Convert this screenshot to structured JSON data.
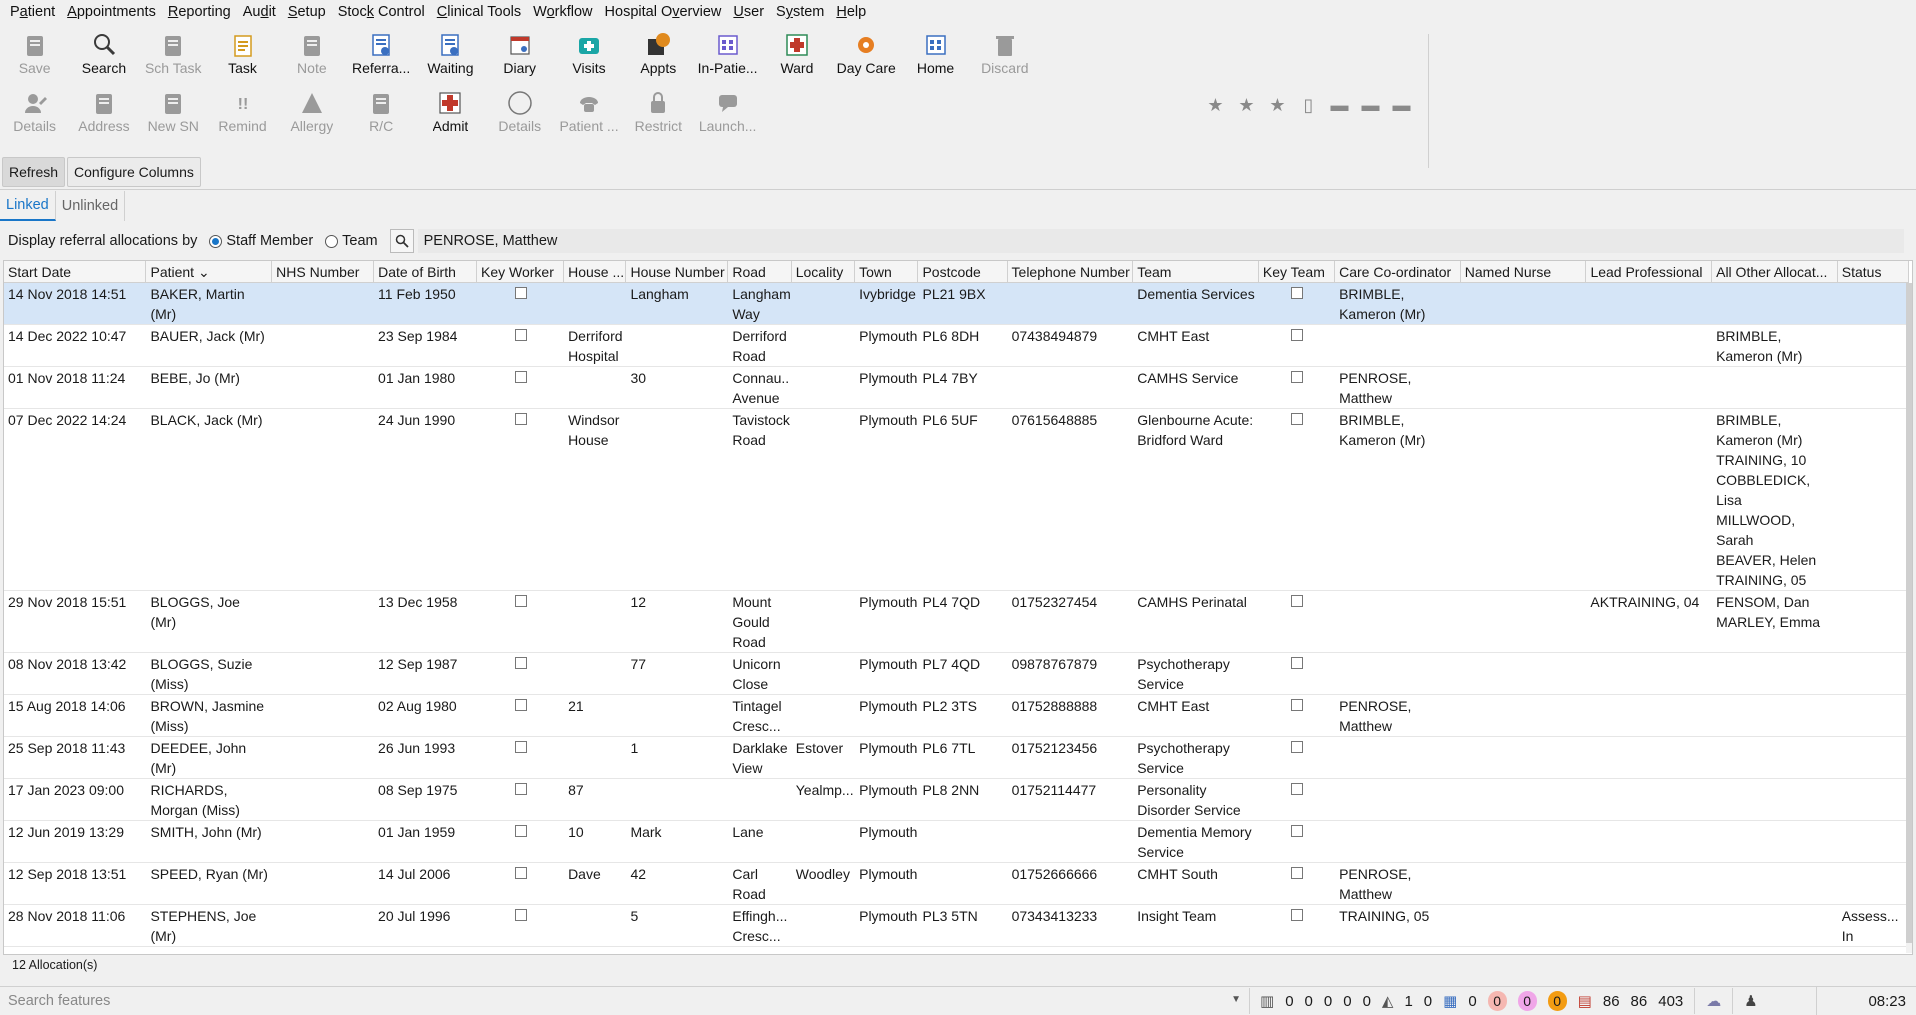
{
  "menu": [
    {
      "pre": "P",
      "ul": "a",
      "post": "tient"
    },
    {
      "pre": "",
      "ul": "A",
      "post": "ppointments"
    },
    {
      "pre": "",
      "ul": "R",
      "post": "eporting"
    },
    {
      "pre": "Au",
      "ul": "d",
      "post": "it"
    },
    {
      "pre": "",
      "ul": "S",
      "post": "etup"
    },
    {
      "pre": "Stoc",
      "ul": "k",
      "post": " Control"
    },
    {
      "pre": "",
      "ul": "C",
      "post": "linical Tools"
    },
    {
      "pre": "W",
      "ul": "o",
      "post": "rkflow"
    },
    {
      "pre": "Hospital O",
      "ul": "v",
      "post": "erview"
    },
    {
      "pre": "",
      "ul": "U",
      "post": "ser"
    },
    {
      "pre": "S",
      "ul": "y",
      "post": "stem"
    },
    {
      "pre": "",
      "ul": "H",
      "post": "elp"
    }
  ],
  "toolbar": {
    "row1": [
      {
        "label": "Save",
        "icon": "save-icon",
        "disabled": true,
        "color": "#9a9a9a"
      },
      {
        "label": "Search",
        "icon": "search-icon",
        "disabled": false,
        "color": "#3a3a3a"
      },
      {
        "label": "Sch Task",
        "icon": "scheduled-task-icon",
        "disabled": true,
        "color": "#9a9a9a"
      },
      {
        "label": "Task",
        "icon": "task-icon",
        "disabled": false,
        "color": "#d49a1e"
      },
      {
        "label": "Note",
        "icon": "note-icon",
        "disabled": true,
        "color": "#9a9a9a"
      },
      {
        "label": "Referra...",
        "icon": "referral-icon",
        "disabled": false,
        "color": "#3a6fc0"
      },
      {
        "label": "Waiting",
        "icon": "waiting-icon",
        "disabled": false,
        "color": "#3a6fc0"
      },
      {
        "label": "Diary",
        "icon": "diary-icon",
        "disabled": false,
        "color": "#c0392b"
      },
      {
        "label": "Visits",
        "icon": "visits-icon",
        "disabled": false,
        "color": "#1aa6a6"
      },
      {
        "label": "Appts",
        "icon": "appointments-icon",
        "disabled": false,
        "color": "#e08a1e"
      },
      {
        "label": "In-Patie...",
        "icon": "inpatient-icon",
        "disabled": false,
        "color": "#6a5acd"
      },
      {
        "label": "Ward",
        "icon": "ward-icon",
        "disabled": false,
        "color": "#2e8b57"
      },
      {
        "label": "Day Care",
        "icon": "day-care-icon",
        "disabled": false,
        "color": "#e67e22"
      },
      {
        "label": "Home",
        "icon": "home-icon",
        "disabled": false,
        "color": "#3a6fc0"
      },
      {
        "label": "Discard",
        "icon": "discard-icon",
        "disabled": true,
        "color": "#9a9a9a"
      }
    ],
    "row2": [
      {
        "label": "Details",
        "icon": "patient-details-icon",
        "disabled": true,
        "color": "#9a9a9a"
      },
      {
        "label": "Address",
        "icon": "address-icon",
        "disabled": true,
        "color": "#9a9a9a"
      },
      {
        "label": "New SN",
        "icon": "new-sn-icon",
        "disabled": true,
        "color": "#9a9a9a"
      },
      {
        "label": "Remind",
        "icon": "remind-icon",
        "disabled": true,
        "color": "#9a9a9a"
      },
      {
        "label": "Allergy",
        "icon": "allergy-icon",
        "disabled": true,
        "color": "#9a9a9a"
      },
      {
        "label": "R/C",
        "icon": "rc-icon",
        "disabled": true,
        "color": "#9a9a9a"
      },
      {
        "label": "Admit",
        "icon": "admit-icon",
        "disabled": false,
        "color": "#c0392b"
      },
      {
        "label": "Details",
        "icon": "details-circle-icon",
        "disabled": true,
        "color": "#9a9a9a"
      },
      {
        "label": "Patient ...",
        "icon": "phone-icon",
        "disabled": true,
        "color": "#9a9a9a"
      },
      {
        "label": "Restrict",
        "icon": "lock-icon",
        "disabled": true,
        "color": "#9a9a9a"
      },
      {
        "label": "Launch...",
        "icon": "chat-icon",
        "disabled": true,
        "color": "#9a9a9a"
      }
    ]
  },
  "actions": {
    "refresh": "Refresh",
    "configure": "Configure Columns"
  },
  "tabs": {
    "linked": "Linked",
    "unlinked": "Unlinked"
  },
  "filter": {
    "label": "Display referral allocations by",
    "staff_member": "Staff Member",
    "team": "Team",
    "selected_staff": "PENROSE, Matthew"
  },
  "grid": {
    "columns": [
      {
        "key": "start",
        "label": "Start Date"
      },
      {
        "key": "patient",
        "label": "Patient ⌄"
      },
      {
        "key": "nhs",
        "label": "NHS Number"
      },
      {
        "key": "dob",
        "label": "Date of Birth"
      },
      {
        "key": "keyworker",
        "label": "Key Worker"
      },
      {
        "key": "house",
        "label": "House ..."
      },
      {
        "key": "housenum",
        "label": "House Number"
      },
      {
        "key": "road",
        "label": "Road"
      },
      {
        "key": "locality",
        "label": "Locality"
      },
      {
        "key": "town",
        "label": "Town"
      },
      {
        "key": "postcode",
        "label": "Postcode"
      },
      {
        "key": "phone",
        "label": "Telephone Number"
      },
      {
        "key": "team",
        "label": "Team"
      },
      {
        "key": "keyteam",
        "label": "Key Team"
      },
      {
        "key": "careco",
        "label": "Care Co-ordinator"
      },
      {
        "key": "nurse",
        "label": "Named Nurse"
      },
      {
        "key": "lead",
        "label": "Lead Professional"
      },
      {
        "key": "others",
        "label": "All Other Allocat..."
      },
      {
        "key": "status",
        "label": "Status"
      }
    ],
    "rows": [
      {
        "start": "14 Nov 2018 14:51",
        "patient": "BAKER, Martin\n (Mr)",
        "nhs": "",
        "dob": "11 Feb 1950",
        "house": "",
        "housenum": "Langham",
        "road": "Langham\n Way",
        "locality": "",
        "town": "Ivybridge",
        "postcode": "PL21 9BX",
        "phone": "",
        "team": "Dementia Services",
        "careco": "BRIMBLE,\n Kameron (Mr)",
        "nurse": "",
        "lead": "",
        "others": "",
        "status": ""
      },
      {
        "start": "14 Dec 2022 10:47",
        "patient": "BAUER, Jack (Mr)",
        "nhs": "",
        "dob": "23 Sep 1984",
        "house": "Derriford\n Hospital",
        "housenum": "",
        "road": "Derriford\n Road",
        "locality": "",
        "town": "Plymouth",
        "postcode": "PL6 8DH",
        "phone": "07438494879",
        "team": "CMHT East",
        "careco": "",
        "nurse": "",
        "lead": "",
        "others": "BRIMBLE,\n Kameron (Mr)",
        "status": ""
      },
      {
        "start": "01 Nov 2018 11:24",
        "patient": "BEBE, Jo (Mr)",
        "nhs": "",
        "dob": "01 Jan 1980",
        "house": "",
        "housenum": "30",
        "road": "Connau..\n Avenue",
        "locality": "",
        "town": "Plymouth",
        "postcode": "PL4 7BY",
        "phone": "",
        "team": "CAMHS Service",
        "careco": "PENROSE,\n Matthew",
        "nurse": "",
        "lead": "",
        "others": "",
        "status": ""
      },
      {
        "start": "07 Dec 2022 14:24",
        "patient": "BLACK, Jack (Mr)",
        "nhs": "",
        "dob": "24 Jun 1990",
        "house": "Windsor\n House",
        "housenum": "",
        "road": "Tavistock\n Road",
        "locality": "",
        "town": "Plymouth",
        "postcode": "PL6 5UF",
        "phone": "07615648885",
        "team": "Glenbourne Acute:\n Bridford Ward",
        "careco": "BRIMBLE,\n Kameron (Mr)",
        "nurse": "",
        "lead": "",
        "others": "BRIMBLE,\n Kameron (Mr)\nTRAINING, 10\nCOBBLEDICK,\n Lisa\nMILLWOOD,\n Sarah\nBEAVER, Helen\nTRAINING, 05",
        "status": ""
      },
      {
        "start": "29 Nov 2018 15:51",
        "patient": "BLOGGS, Joe (Mr)",
        "nhs": "",
        "dob": "13 Dec 1958",
        "house": "",
        "housenum": "12",
        "road": "Mount\n Gould\n Road",
        "locality": "",
        "town": "Plymouth",
        "postcode": "PL4 7QD",
        "phone": "01752327454",
        "team": "CAMHS Perinatal",
        "careco": "",
        "nurse": "",
        "lead": "AKTRAINING, 04",
        "others": "FENSOM, Dan\nMARLEY, Emma",
        "status": ""
      },
      {
        "start": "08 Nov 2018 13:42",
        "patient": "BLOGGS, Suzie\n (Miss)",
        "nhs": "",
        "dob": "12 Sep 1987",
        "house": "",
        "housenum": "77",
        "road": "Unicorn\n Close",
        "locality": "",
        "town": "Plymouth",
        "postcode": "PL7 4QD",
        "phone": "09878767879",
        "team": "Psychotherapy\n Service",
        "careco": "",
        "nurse": "",
        "lead": "",
        "others": "",
        "status": ""
      },
      {
        "start": "15 Aug 2018 14:06",
        "patient": "BROWN, Jasmine\n (Miss)",
        "nhs": "",
        "dob": "02 Aug 1980",
        "house": "21",
        "housenum": "",
        "road": "Tintagel\n Cresc...",
        "locality": "",
        "town": "Plymouth",
        "postcode": "PL2 3TS",
        "phone": "01752888888",
        "team": "CMHT East",
        "careco": "PENROSE,\n Matthew",
        "nurse": "",
        "lead": "",
        "others": "",
        "status": ""
      },
      {
        "start": "25 Sep 2018 11:43",
        "patient": "DEEDEE, John\n (Mr)",
        "nhs": "",
        "dob": "26 Jun 1993",
        "house": "",
        "housenum": "1",
        "road": "Darklake\n View",
        "locality": "Estover",
        "town": "Plymouth",
        "postcode": "PL6 7TL",
        "phone": "01752123456",
        "team": "Psychotherapy\n Service",
        "careco": "",
        "nurse": "",
        "lead": "",
        "others": "",
        "status": ""
      },
      {
        "start": "17 Jan 2023 09:00",
        "patient": "RICHARDS,\n Morgan (Miss)",
        "nhs": "",
        "dob": "08 Sep 1975",
        "house": "87",
        "housenum": "",
        "road": "",
        "locality": "Yealmp...",
        "town": "Plymouth",
        "postcode": "PL8 2NN",
        "phone": "01752114477",
        "team": "Personality\n Disorder Service",
        "careco": "",
        "nurse": "",
        "lead": "",
        "others": "",
        "status": ""
      },
      {
        "start": "12 Jun 2019 13:29",
        "patient": "SMITH, John (Mr)",
        "nhs": "",
        "dob": "01 Jan 1959",
        "house": "10",
        "housenum": "Mark",
        "road": "Lane",
        "locality": "",
        "town": "Plymouth",
        "postcode": "",
        "phone": "",
        "team": "Dementia Memory\n Service",
        "careco": "",
        "nurse": "",
        "lead": "",
        "others": "",
        "status": ""
      },
      {
        "start": "12 Sep 2018 13:51",
        "patient": "SPEED, Ryan (Mr)",
        "nhs": "",
        "dob": "14 Jul 2006",
        "house": "Dave",
        "housenum": "42",
        "road": "Carl\n Road",
        "locality": "Woodley",
        "town": "Plymouth",
        "postcode": "",
        "phone": "01752666666",
        "team": "CMHT South",
        "careco": "PENROSE,\n Matthew",
        "nurse": "",
        "lead": "",
        "others": "",
        "status": ""
      },
      {
        "start": "28 Nov 2018 11:06",
        "patient": "STEPHENS, Joe\n (Mr)",
        "nhs": "",
        "dob": "20 Jul 1996",
        "house": "",
        "housenum": "5",
        "road": "Effingh...\n Cresc...",
        "locality": "",
        "town": "Plymouth",
        "postcode": "PL3 5TN",
        "phone": "07343413233",
        "team": "Insight Team",
        "careco": "TRAINING, 05",
        "nurse": "",
        "lead": "",
        "others": "",
        "status": "Assess...\n In\n Progress"
      }
    ]
  },
  "count_label": "12 Allocation(s)",
  "statusbar": {
    "search_placeholder": "Search features",
    "counts_a": [
      "0",
      "0",
      "0",
      "0",
      "0"
    ],
    "counts_b": [
      "1",
      "0"
    ],
    "count_c": "0",
    "pills": [
      {
        "value": "0",
        "color": "#f5b7b1"
      },
      {
        "value": "0",
        "color": "#f0a6e8"
      },
      {
        "value": "0",
        "color": "#f39c12"
      }
    ],
    "counts_d": [
      "86",
      "86",
      "403"
    ],
    "time": "08:23"
  }
}
